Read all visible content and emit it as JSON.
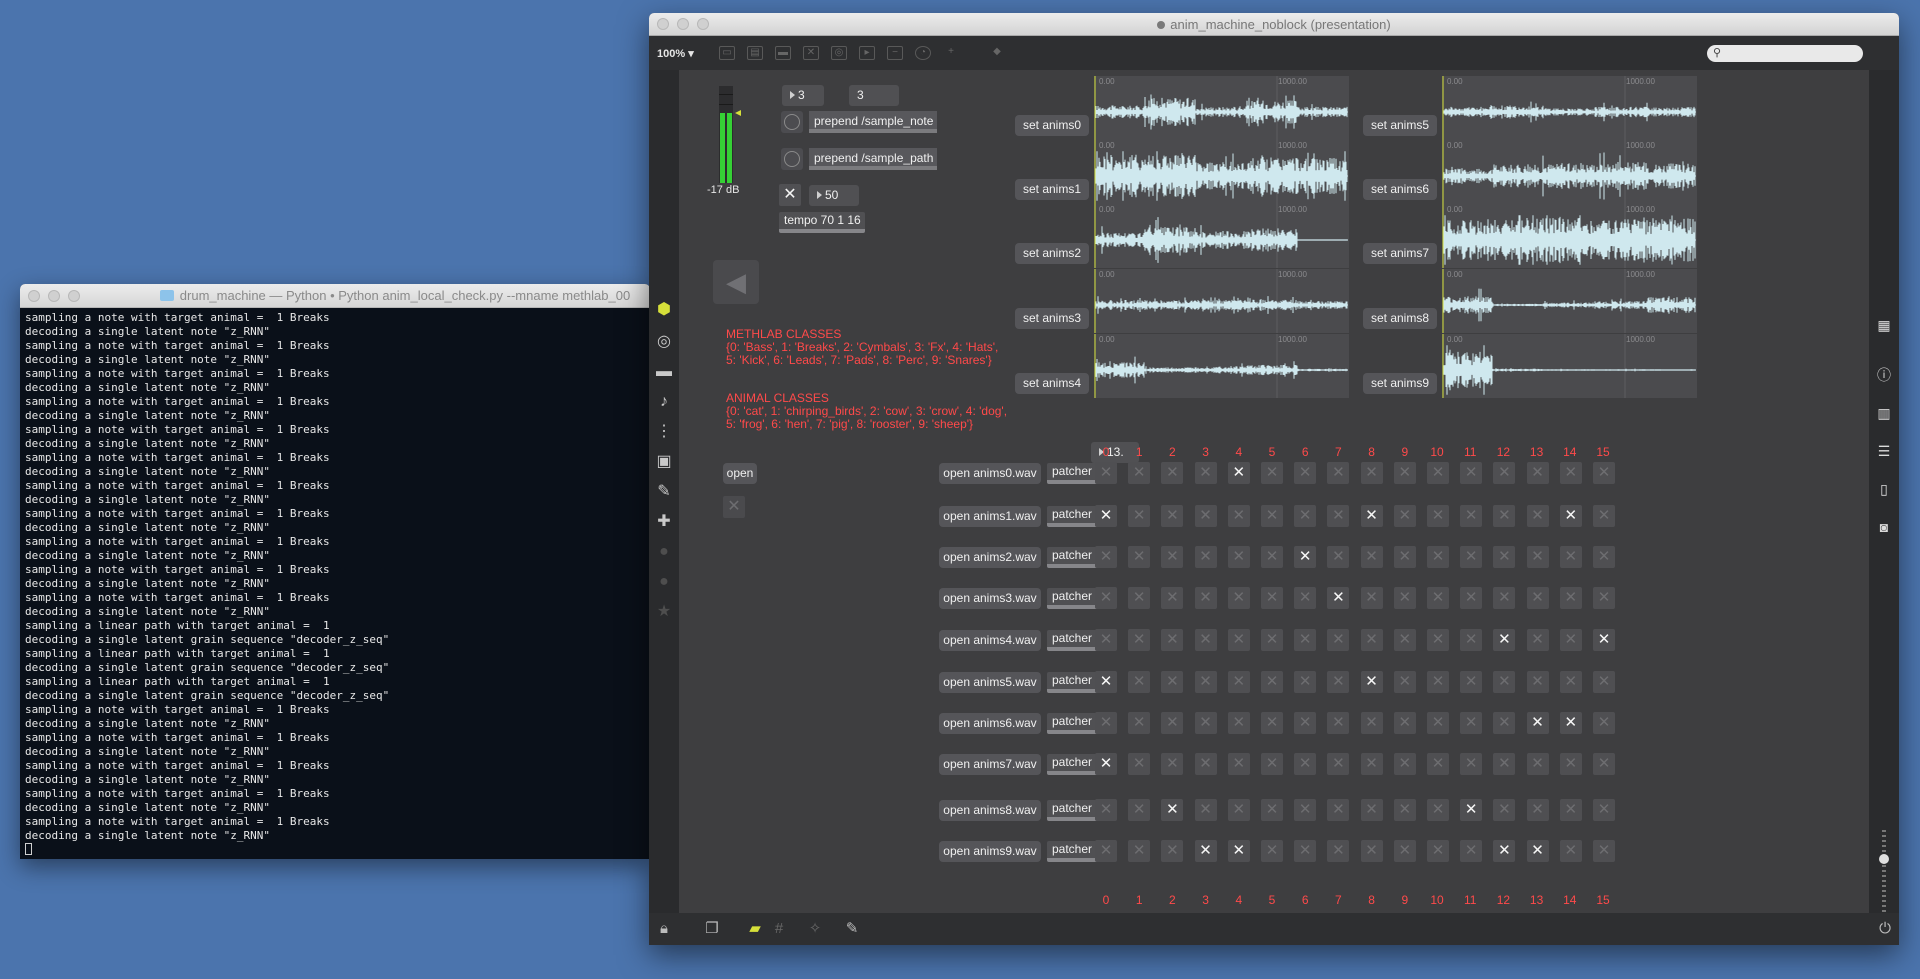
{
  "terminal": {
    "title": "drum_machine — Python • Python anim_local_check.py --mname methlab_00",
    "lines": [
      "sampling a note with target animal =  1 Breaks",
      "decoding a single latent note \"z_RNN\"",
      "sampling a note with target animal =  1 Breaks",
      "decoding a single latent note \"z_RNN\"",
      "sampling a note with target animal =  1 Breaks",
      "decoding a single latent note \"z_RNN\"",
      "sampling a note with target animal =  1 Breaks",
      "decoding a single latent note \"z_RNN\"",
      "sampling a note with target animal =  1 Breaks",
      "decoding a single latent note \"z_RNN\"",
      "sampling a note with target animal =  1 Breaks",
      "decoding a single latent note \"z_RNN\"",
      "sampling a note with target animal =  1 Breaks",
      "decoding a single latent note \"z_RNN\"",
      "sampling a note with target animal =  1 Breaks",
      "decoding a single latent note \"z_RNN\"",
      "sampling a note with target animal =  1 Breaks",
      "decoding a single latent note \"z_RNN\"",
      "sampling a note with target animal =  1 Breaks",
      "decoding a single latent note \"z_RNN\"",
      "sampling a note with target animal =  1 Breaks",
      "decoding a single latent note \"z_RNN\"",
      "sampling a linear path with target animal =  1",
      "decoding a single latent grain sequence \"decoder_z_seq\"",
      "sampling a linear path with target animal =  1",
      "decoding a single latent grain sequence \"decoder_z_seq\"",
      "sampling a linear path with target animal =  1",
      "decoding a single latent grain sequence \"decoder_z_seq\"",
      "sampling a note with target animal =  1 Breaks",
      "decoding a single latent note \"z_RNN\"",
      "sampling a note with target animal =  1 Breaks",
      "decoding a single latent note \"z_RNN\"",
      "sampling a note with target animal =  1 Breaks",
      "decoding a single latent note \"z_RNN\"",
      "sampling a note with target animal =  1 Breaks",
      "decoding a single latent note \"z_RNN\"",
      "sampling a note with target animal =  1 Breaks",
      "decoding a single latent note \"z_RNN\""
    ]
  },
  "max": {
    "title": "anim_machine_noblock (presentation)",
    "zoom": "100% ▾",
    "meter_label": "-17 dB",
    "num_a": "3",
    "num_b": "3",
    "prepend_note": "prepend /sample_note",
    "prepend_path": "prepend /sample_path",
    "tempo_num": "50",
    "tempo_msg": "tempo 70 1 16",
    "methlab_title": "METHLAB CLASSES",
    "methlab_line1": "{0: 'Bass', 1: 'Breaks', 2: 'Cymbals', 3: 'Fx', 4: 'Hats',",
    "methlab_line2": "5: 'Kick', 6: 'Leads', 7: 'Pads', 8: 'Perc', 9: 'Snares'}",
    "animal_title": "ANIMAL CLASSES",
    "animal_line1": "{0: 'cat', 1: 'chirping_birds', 2: 'cow', 3: 'crow', 4: 'dog',",
    "animal_line2": "5: 'frog', 6: 'hen', 7: 'pig', 8: 'rooster', 9: 'sheep'}",
    "open_label": "open",
    "grid_num": "13.",
    "wave_lbl0": "0.00",
    "wave_lbl1": "1000.00",
    "set_anims": [
      "set anims0",
      "set anims1",
      "set anims2",
      "set anims3",
      "set anims4",
      "set anims5",
      "set anims6",
      "set anims7",
      "set anims8",
      "set anims9"
    ],
    "open_files": [
      "open anims0.wav",
      "open anims1.wav",
      "open anims2.wav",
      "open anims3.wav",
      "open anims4.wav",
      "open anims5.wav",
      "open anims6.wav",
      "open anims7.wav",
      "open anims8.wav",
      "open anims9.wav"
    ],
    "patcher_label": "patcher",
    "columns": [
      "0",
      "1",
      "2",
      "3",
      "4",
      "5",
      "6",
      "7",
      "8",
      "9",
      "10",
      "11",
      "12",
      "13",
      "14",
      "15"
    ],
    "grid_on": [
      [
        4
      ],
      [
        0,
        8,
        14
      ],
      [
        6
      ],
      [
        7
      ],
      [
        12,
        15
      ],
      [
        0,
        8
      ],
      [
        13,
        14
      ],
      [
        0
      ],
      [
        2,
        11
      ],
      [
        3,
        4,
        12,
        13
      ]
    ]
  },
  "colors": {
    "accent_red": "#ff4a4a",
    "meter_green": "#35d135",
    "desktop": "#4b74ad"
  }
}
